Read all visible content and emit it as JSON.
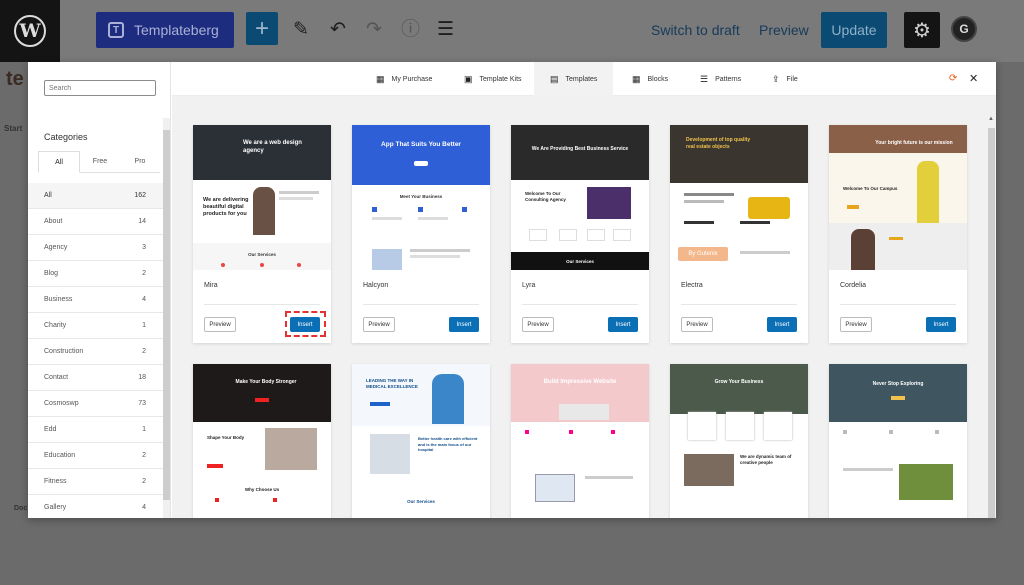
{
  "topbar": {
    "plugin_button": "Templateberg",
    "switch_draft": "Switch to draft",
    "preview": "Preview",
    "update": "Update",
    "plugin_icon_letter": "T",
    "g_icon_letter": "G"
  },
  "background": {
    "title_fragment": "te",
    "start_fragment": "Start",
    "doc_fragment": "Doc"
  },
  "sidebar": {
    "search_placeholder": "Search",
    "categories_title": "Categories",
    "tabs": [
      "All",
      "Free",
      "Pro"
    ],
    "categories": [
      {
        "name": "All",
        "count": "162"
      },
      {
        "name": "About",
        "count": "14"
      },
      {
        "name": "Agency",
        "count": "3"
      },
      {
        "name": "Blog",
        "count": "2"
      },
      {
        "name": "Business",
        "count": "4"
      },
      {
        "name": "Charity",
        "count": "1"
      },
      {
        "name": "Construction",
        "count": "2"
      },
      {
        "name": "Contact",
        "count": "18"
      },
      {
        "name": "Cosmoswp",
        "count": "73"
      },
      {
        "name": "Edd",
        "count": "1"
      },
      {
        "name": "Education",
        "count": "2"
      },
      {
        "name": "Fitness",
        "count": "2"
      },
      {
        "name": "Gallery",
        "count": "4"
      }
    ]
  },
  "header_tabs": [
    {
      "label": "My Purchase",
      "icon": "grid-icon"
    },
    {
      "label": "Template Kits",
      "icon": "kit-icon"
    },
    {
      "label": "Templates",
      "icon": "table-icon"
    },
    {
      "label": "Blocks",
      "icon": "blocks-icon"
    },
    {
      "label": "Patterns",
      "icon": "list-icon"
    },
    {
      "label": "File",
      "icon": "upload-icon"
    }
  ],
  "buttons": {
    "preview": "Preview",
    "insert": "Insert"
  },
  "templates": [
    {
      "name": "Mira",
      "headline": "We are a web design agency",
      "sub": "We are delivering beautiful digital products for you",
      "section": "Our Services"
    },
    {
      "name": "Halcyon",
      "headline": "App That Suits You Better",
      "section": "Meet Your Business"
    },
    {
      "name": "Lyra",
      "headline": "We Are Providing Best Business Service",
      "sub": "Welcome To Our Consulting Agency",
      "section": "Our Services"
    },
    {
      "name": "Electra",
      "headline": "Development of top quality real estate objects",
      "badge": "By Gutenix"
    },
    {
      "name": "Cordelia",
      "headline": "Your bright future is our mission",
      "sub": "Welcome To Our Campus"
    },
    {
      "headline": "Make Your Body Stronger",
      "sub": "Shape Your Body",
      "section": "Why Choose Us"
    },
    {
      "headline": "LEADING THE WAY IN MEDICAL EXCELLENCE",
      "sub": "Better health care with efficient and is the main focus of our hospital",
      "section": "Our Services"
    },
    {
      "headline": "Build Impressive Website"
    },
    {
      "headline": "Grow Your Business",
      "sub": "We are dynamic team of creative people"
    },
    {
      "headline": "Never Stop Exploring"
    }
  ],
  "colors": {
    "insert": "#0a6fb4",
    "highlight": "#e53131",
    "accent": "#e8590c"
  }
}
